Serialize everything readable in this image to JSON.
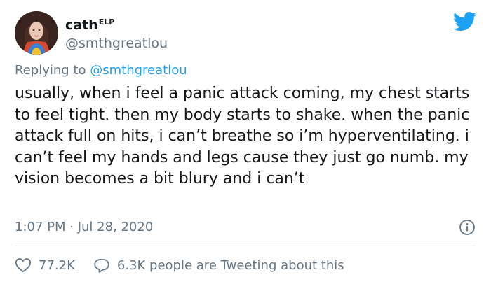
{
  "tweet": {
    "author": {
      "display_name": "cath",
      "name_superscript": "ELP",
      "handle": "@smthgreatlou"
    },
    "reply": {
      "prefix": "Replying to",
      "mention": "@smthgreatlou"
    },
    "text": "usually, when i feel a panic attack coming, my chest starts to feel tight. then my body starts to shake. when the panic attack full on hits, i can’t breathe so i’m hyperventilating. i can’t feel my hands and legs cause they just go numb. my vision becomes a bit blury and i can’t",
    "timestamp": "1:07 PM · Jul 28, 2020",
    "likes": "77.2K",
    "conversation": "6.3K people are Tweeting about this"
  },
  "colors": {
    "brand_blue": "#1da1f2",
    "secondary_text": "#657786",
    "primary_text": "#14171a",
    "divider": "#e1e8ed"
  },
  "icons": {
    "logo": "twitter-bird-icon",
    "info": "info-icon",
    "like": "heart-icon",
    "reply": "speech-bubble-icon"
  }
}
